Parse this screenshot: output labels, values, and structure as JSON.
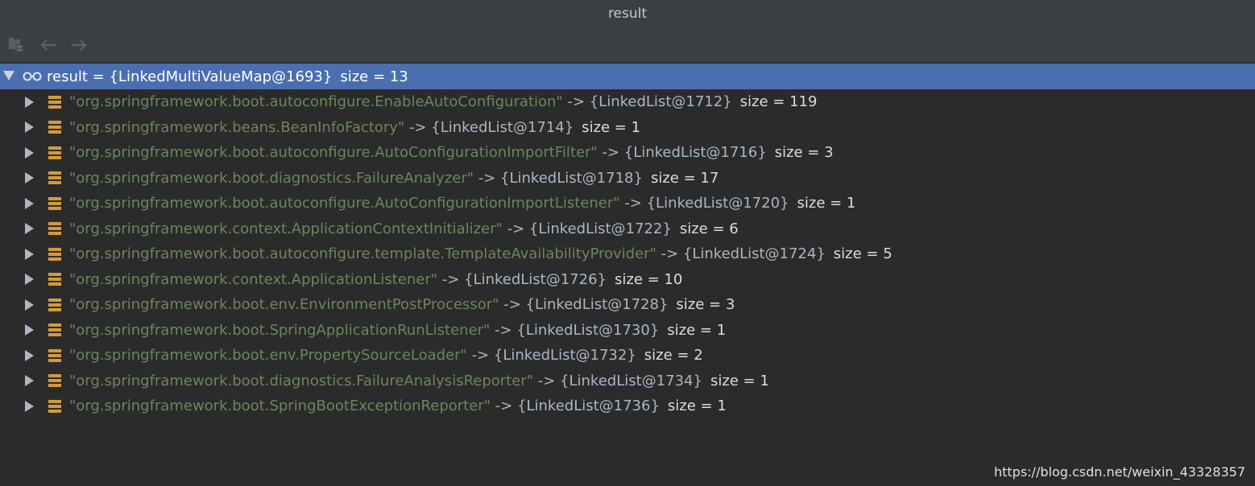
{
  "window": {
    "title": "result"
  },
  "toolbar": {
    "buttons": [
      {
        "icon": "folder-tree-icon",
        "enabled": false
      },
      {
        "icon": "back-arrow-icon",
        "enabled": false
      },
      {
        "icon": "forward-arrow-icon",
        "enabled": false
      }
    ]
  },
  "colors": {
    "selection": "#4b6eaf",
    "string": "#6a8759",
    "field_icon": "#d49b3c",
    "background": "#2b2b2b"
  },
  "root": {
    "name": "result",
    "eq": " = ",
    "object": "{LinkedMultiValueMap@1693}",
    "size": "size = 13"
  },
  "rows": [
    {
      "key": "\"org.springframework.boot.autoconfigure.EnableAutoConfiguration\"",
      "arrow": " -> ",
      "object": "{LinkedList@1712}",
      "size": "size = 119"
    },
    {
      "key": "\"org.springframework.beans.BeanInfoFactory\"",
      "arrow": " -> ",
      "object": "{LinkedList@1714}",
      "size": "size = 1"
    },
    {
      "key": "\"org.springframework.boot.autoconfigure.AutoConfigurationImportFilter\"",
      "arrow": " -> ",
      "object": "{LinkedList@1716}",
      "size": "size = 3"
    },
    {
      "key": "\"org.springframework.boot.diagnostics.FailureAnalyzer\"",
      "arrow": " -> ",
      "object": "{LinkedList@1718}",
      "size": "size = 17"
    },
    {
      "key": "\"org.springframework.boot.autoconfigure.AutoConfigurationImportListener\"",
      "arrow": " -> ",
      "object": "{LinkedList@1720}",
      "size": "size = 1"
    },
    {
      "key": "\"org.springframework.context.ApplicationContextInitializer\"",
      "arrow": " -> ",
      "object": "{LinkedList@1722}",
      "size": "size = 6"
    },
    {
      "key": "\"org.springframework.boot.autoconfigure.template.TemplateAvailabilityProvider\"",
      "arrow": " -> ",
      "object": "{LinkedList@1724}",
      "size": "size = 5"
    },
    {
      "key": "\"org.springframework.context.ApplicationListener\"",
      "arrow": " -> ",
      "object": "{LinkedList@1726}",
      "size": "size = 10"
    },
    {
      "key": "\"org.springframework.boot.env.EnvironmentPostProcessor\"",
      "arrow": " -> ",
      "object": "{LinkedList@1728}",
      "size": "size = 3"
    },
    {
      "key": "\"org.springframework.boot.SpringApplicationRunListener\"",
      "arrow": " -> ",
      "object": "{LinkedList@1730}",
      "size": "size = 1"
    },
    {
      "key": "\"org.springframework.boot.env.PropertySourceLoader\"",
      "arrow": " -> ",
      "object": "{LinkedList@1732}",
      "size": "size = 2"
    },
    {
      "key": "\"org.springframework.boot.diagnostics.FailureAnalysisReporter\"",
      "arrow": " -> ",
      "object": "{LinkedList@1734}",
      "size": "size = 1"
    },
    {
      "key": "\"org.springframework.boot.SpringBootExceptionReporter\"",
      "arrow": " -> ",
      "object": "{LinkedList@1736}",
      "size": "size = 1"
    }
  ],
  "watermark": "https://blog.csdn.net/weixin_43328357"
}
